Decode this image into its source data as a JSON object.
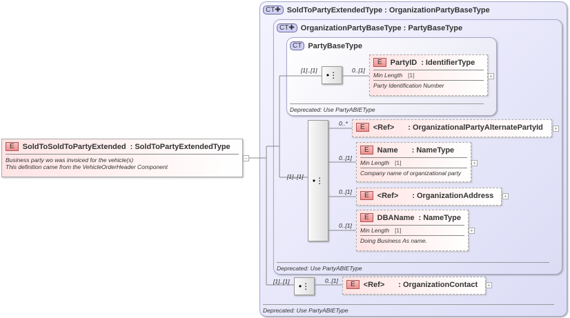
{
  "root": {
    "badge": "E",
    "name": "SoldToSoldToPartyExtended",
    "type": ": SoldToPartyExtendedType",
    "doc": [
      "Business party wo was invoiced for the vehicle(s)",
      "This definition came from the VehicleOrderHeader Component"
    ],
    "expander": "−"
  },
  "outer_type": {
    "badge": "CT✚",
    "title": "SoldToPartyExtendedType : OrganizationPartyBaseType",
    "footer": "Deprecated: Use PartyABIEType"
  },
  "middle_type": {
    "badge": "CT✚",
    "title": "OrganizationPartyBaseType : PartyBaseType",
    "footer": "Deprecated: Use PartyABIEType"
  },
  "inner_type": {
    "badge": "CT",
    "title": "PartyBaseType",
    "footer": "Deprecated: Use PartyABIEType"
  },
  "seq_icon": "sequence-icon",
  "seq_glyph": "•⋮",
  "elements": [
    {
      "badge": "E",
      "name": "PartyID",
      "type": ": IdentifierType",
      "facet": "Min Length",
      "facet_value": "[1]",
      "doc": "Party Identification Number",
      "card": "0..[1]",
      "seq_card": "[1]..[1]"
    },
    {
      "badge": "E",
      "name": "<Ref>",
      "type": ": OrganizationalPartyAlternatePartyId",
      "card": "0..*",
      "seq_card": "[1]..[1]"
    },
    {
      "badge": "E",
      "name": "Name",
      "type": ": NameType",
      "facet": "Min Length",
      "facet_value": "[1]",
      "doc": "Company name of organizational party",
      "card": "0..[1]"
    },
    {
      "badge": "E",
      "name": "<Ref>",
      "type": ": OrganizationAddress",
      "card": "0..[1]"
    },
    {
      "badge": "E",
      "name": "DBAName",
      "type": ": NameType",
      "facet": "Min Length",
      "facet_value": "[1]",
      "doc": "Doing Business As name.",
      "card": "0..[1]"
    },
    {
      "badge": "E",
      "name": "<Ref>",
      "type": ": OrganizationContact",
      "card": "0..[1]",
      "seq_card": "[1]..[1]"
    }
  ],
  "expander": "+"
}
